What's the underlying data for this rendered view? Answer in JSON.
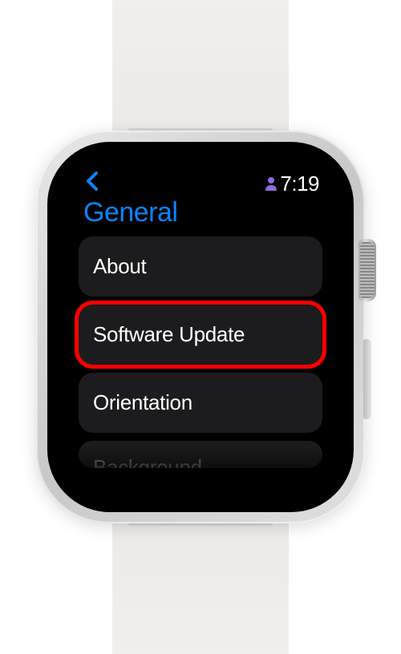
{
  "status": {
    "time": "7:19"
  },
  "page": {
    "title": "General"
  },
  "menu": {
    "items": [
      {
        "label": "About",
        "highlighted": false
      },
      {
        "label": "Software Update",
        "highlighted": true
      },
      {
        "label": "Orientation",
        "highlighted": false
      },
      {
        "label": "Background",
        "highlighted": false,
        "cut": true
      }
    ]
  },
  "colors": {
    "accent": "#0a84ff",
    "highlight": "#ff0000",
    "cell": "#1c1c1e"
  }
}
